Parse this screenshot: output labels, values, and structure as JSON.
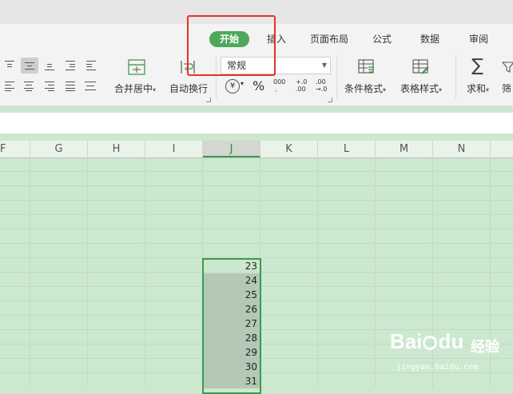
{
  "tabs": [
    {
      "label": "开始",
      "active": true
    },
    {
      "label": "插入"
    },
    {
      "label": "页面布局"
    },
    {
      "label": "公式"
    },
    {
      "label": "数据"
    },
    {
      "label": "审阅"
    }
  ],
  "ribbon": {
    "merge_label": "合并居中",
    "wrap_label": "自动换行",
    "number_format": "常规",
    "currency_symbol": "¥",
    "percent_symbol": "%",
    "thousands_symbol": "000",
    "inc_decimal_label": "+.0\n.00",
    "dec_decimal_label": ".00\n→.0",
    "conditional_format_label": "条件格式",
    "table_style_label": "表格样式",
    "sum_label": "求和",
    "filter_label": "筛"
  },
  "columns": [
    "F",
    "G",
    "H",
    "I",
    "J",
    "K",
    "L",
    "M",
    "N"
  ],
  "active_column": "J",
  "cells": [
    "23",
    "24",
    "25",
    "26",
    "27",
    "28",
    "29",
    "30",
    "31"
  ],
  "watermark": {
    "logo": "Bai",
    "logo_suffix": "du",
    "cn": "经验",
    "url": "jingyan.baidu.com"
  },
  "colors": {
    "accent_green": "#4ea85b",
    "highlight_red": "#e8302a",
    "sheet_bg": "#cce8cf"
  }
}
